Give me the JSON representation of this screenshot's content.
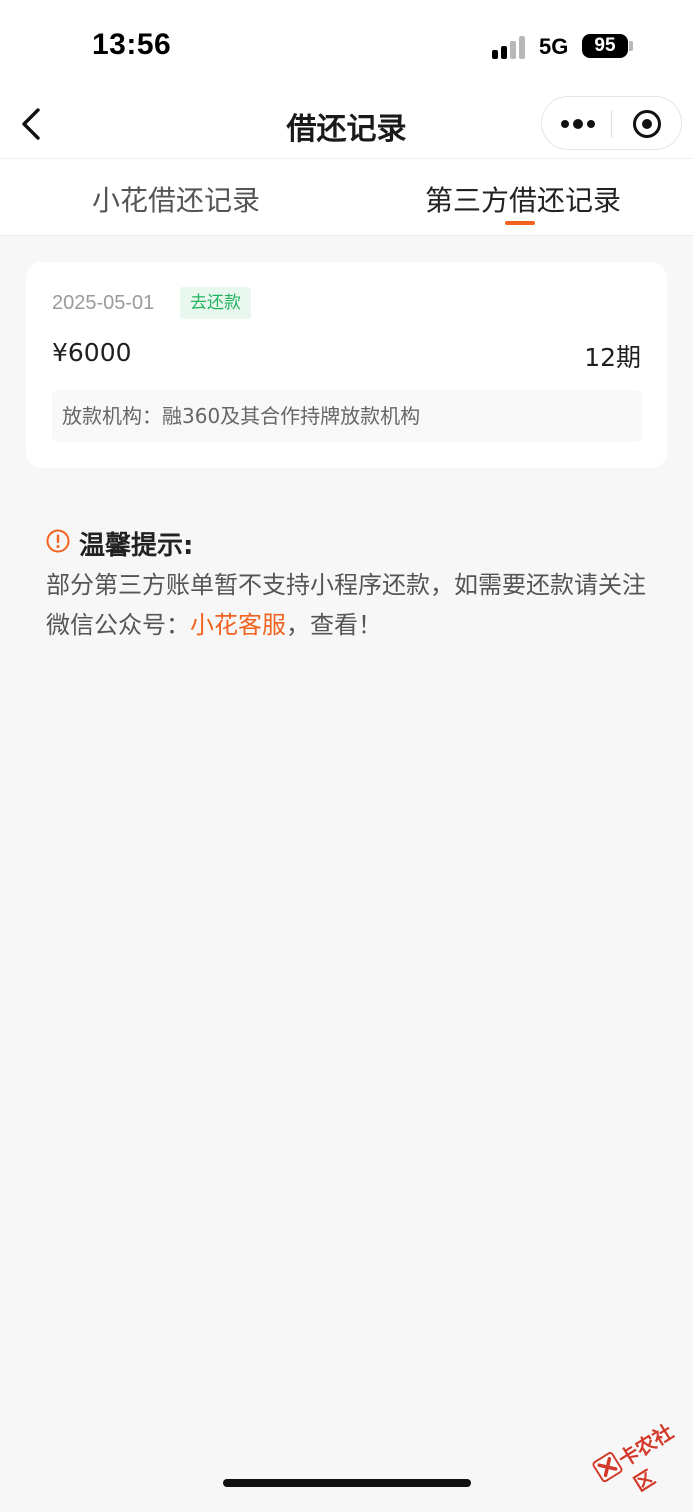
{
  "status_bar": {
    "time": "13:56",
    "network": "5G",
    "battery": "95"
  },
  "nav": {
    "title": "借还记录"
  },
  "tabs": [
    {
      "label": "小花借还记录",
      "active": false
    },
    {
      "label": "第三方借还记录",
      "active": true
    }
  ],
  "record": {
    "date": "2025-05-01",
    "badge": "去还款",
    "amount": "¥6000",
    "term": "12期",
    "org": "放款机构：融360及其合作持牌放款机构"
  },
  "tip": {
    "title": "温馨提示:",
    "body_prefix": "部分第三方账单暂不支持小程序还款，如需要还款请关注微信公众号：",
    "link": "小花客服",
    "body_suffix": "，查看！"
  },
  "watermark": {
    "text": "卡农社区"
  },
  "colors": {
    "accent": "#f2621f",
    "badge_text": "#22b460",
    "badge_bg": "#e9f8ef"
  }
}
